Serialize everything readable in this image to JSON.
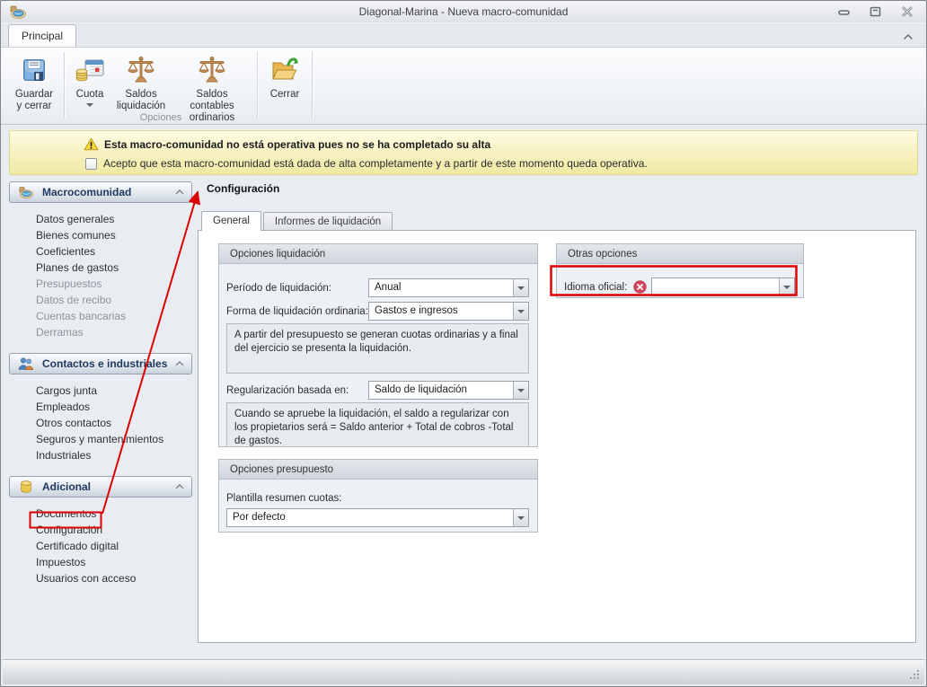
{
  "window": {
    "title": "Diagonal-Marina - Nueva macro-comunidad"
  },
  "ribbon": {
    "tab": "Principal",
    "group_label": "Opciones",
    "buttons": [
      {
        "label": "Guardar y cerrar",
        "icon": "floppy-disk-icon"
      },
      {
        "label": "Cuota",
        "icon": "coins-calendar-icon",
        "has_dropdown": true
      },
      {
        "label": "Saldos liquidación",
        "icon": "scales-icon"
      },
      {
        "label": "Saldos contables ordinarios",
        "icon": "scales-icon"
      },
      {
        "label": "Cerrar",
        "icon": "folder-arrow-icon"
      }
    ]
  },
  "banner": {
    "title": "Esta macro-comunidad no está operativa pues no se ha completado su alta",
    "checkbox_label": "Acepto que esta macro-comunidad está dada de alta completamente y a partir de este momento queda operativa.",
    "checkbox_checked": false,
    "icon": "warning-triangle-icon"
  },
  "sidebar": {
    "groups": [
      {
        "title": "Macrocomunidad",
        "icon": "community-icon",
        "items": [
          {
            "label": "Datos generales",
            "enabled": true
          },
          {
            "label": "Bienes comunes",
            "enabled": true
          },
          {
            "label": "Coeficientes",
            "enabled": true
          },
          {
            "label": "Planes de gastos",
            "enabled": true
          },
          {
            "label": "Presupuestos",
            "enabled": false
          },
          {
            "label": "Datos de recibo",
            "enabled": false
          },
          {
            "label": "Cuentas bancarias",
            "enabled": false
          },
          {
            "label": "Derramas",
            "enabled": false
          }
        ]
      },
      {
        "title": "Contactos e industriales",
        "icon": "people-icon",
        "items": [
          {
            "label": "Cargos junta",
            "enabled": true
          },
          {
            "label": "Empleados",
            "enabled": true
          },
          {
            "label": "Otros contactos",
            "enabled": true
          },
          {
            "label": "Seguros y mantenimientos",
            "enabled": true
          },
          {
            "label": "Industriales",
            "enabled": true
          }
        ]
      },
      {
        "title": "Adicional",
        "icon": "database-icon",
        "items": [
          {
            "label": "Documentos",
            "enabled": true
          },
          {
            "label": "Configuración",
            "enabled": true,
            "highlighted": true
          },
          {
            "label": "Certificado digital",
            "enabled": true
          },
          {
            "label": "Impuestos",
            "enabled": true
          },
          {
            "label": "Usuarios con acceso",
            "enabled": true
          }
        ]
      }
    ]
  },
  "main": {
    "title": "Configuración",
    "tabs": [
      {
        "label": "General",
        "active": true
      },
      {
        "label": "Informes de liquidación",
        "active": false
      }
    ],
    "opciones_liquidacion": {
      "title": "Opciones liquidación",
      "periodo_label": "Período de liquidación:",
      "periodo_value": "Anual",
      "forma_label": "Forma de liquidación ordinaria:",
      "forma_value": "Gastos e ingresos",
      "forma_info": "A partir del presupuesto se generan cuotas ordinarias y a final del ejercicio se presenta la liquidación.",
      "regularizacion_label": "Regularización basada en:",
      "regularizacion_value": "Saldo de liquidación",
      "regularizacion_info": "Cuando se apruebe la liquidación, el saldo a regularizar con los propietarios será = Saldo anterior + Total de cobros -Total de gastos."
    },
    "otras_opciones": {
      "title": "Otras opciones",
      "idioma_label": "Idioma oficial:",
      "idioma_value": "",
      "idioma_error": true,
      "error_icon": "error-circle-icon"
    },
    "opciones_presupuesto": {
      "title": "Opciones presupuesto",
      "plantilla_label": "Plantilla resumen cuotas:",
      "plantilla_value": "Por defecto"
    }
  },
  "colors": {
    "annotation_red": "#dd0000",
    "error_icon_red": "#d6445f",
    "banner_background": "#f5efae",
    "sidebar_header_text": "#1f3a60"
  }
}
